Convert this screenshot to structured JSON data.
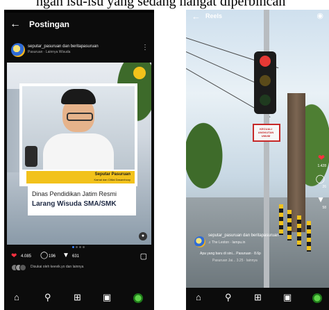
{
  "caption": "ngan isu-isu yang sedang hangat diperbincan",
  "left": {
    "header": {
      "title": "Postingan",
      "back_icon": "arrow-left-icon"
    },
    "post": {
      "account": "seputar_pasuruan dan beritapasuruan",
      "account_sub": "Pasuruan · Lainnya Wisuda",
      "more_icon": "more-vert-icon",
      "brand_line1": "Seputar Pasuruan",
      "brand_line2": "Kamal dan Citilal Dasarxhooy",
      "headline_line1": "Dinas Pendidikan Jatim Resmi",
      "headline_line2": "Larang Wisuda SMA/SMK",
      "likes": "4.085",
      "comments": "196",
      "shares": "631",
      "liked_by": "Disukai oleh keevik.yo dan lainnya"
    },
    "nav": [
      "home-icon",
      "search-icon",
      "add-icon",
      "reels-icon",
      "profile-avatar"
    ]
  },
  "right": {
    "header": {
      "title": "Reels",
      "back_icon": "arrow-left-icon",
      "camera_icon": "camera-icon"
    },
    "side": {
      "likes": "1.428",
      "comments": "26",
      "shares": "58"
    },
    "sign_text": "KECUALI ANGKUTAN UMUM",
    "info": {
      "account": "seputar_pasuruan dan beritapasuruan",
      "audio": "♫ The Lexton · lampu.in",
      "caption": "Apa yang baru di sini... Pasuruan · 8.6p",
      "meta": "Pasuruan Jai... 3.25 · lainnya"
    },
    "traffic_colors": {
      "red": "#e53935",
      "yellow": "#5a4a1a",
      "green": "#1f3a1f"
    }
  }
}
